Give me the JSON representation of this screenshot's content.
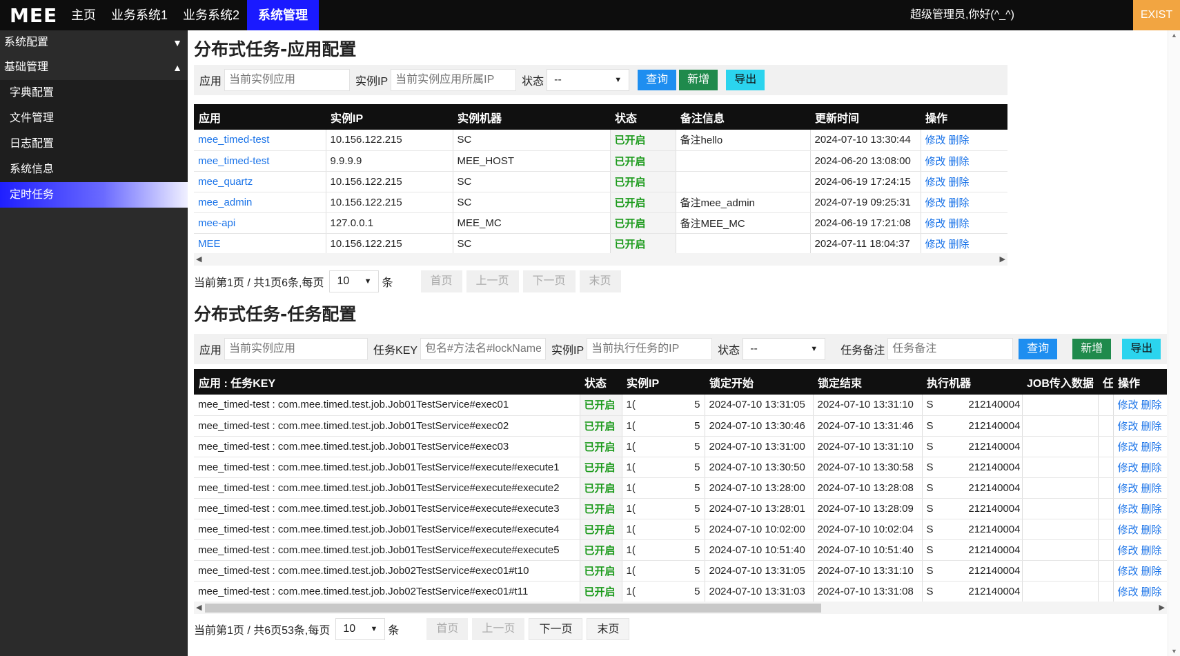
{
  "header": {
    "logo": "MEE",
    "nav": [
      "主页",
      "业务系统1",
      "业务系统2",
      "系统管理"
    ],
    "active_nav": "系统管理",
    "greeting": "超级管理员,你好(^_^)",
    "exit_label": "EXIST"
  },
  "sidebar": {
    "groups": [
      {
        "label": "系统配置",
        "caret": "▼"
      },
      {
        "label": "基础管理",
        "caret": "▲"
      }
    ],
    "items": [
      "字典配置",
      "文件管理",
      "日志配置",
      "系统信息",
      "定时任务"
    ],
    "active_item": "定时任务"
  },
  "app_section": {
    "title": "分布式任务-应用配置",
    "filter": {
      "app_label": "应用",
      "app_placeholder": "当前实例应用",
      "ip_label": "实例IP",
      "ip_placeholder": "当前实例应用所属IP",
      "status_label": "状态",
      "status_value": "--",
      "query": "查询",
      "add": "新增",
      "export": "导出"
    },
    "columns": [
      "应用",
      "实例IP",
      "实例机器",
      "状态",
      "备注信息",
      "更新时间",
      "操作"
    ],
    "rows": [
      {
        "app": "mee_timed-test",
        "ip": "10.156.122.215",
        "machine": "SC",
        "status": "已开启",
        "remark": "备注hello",
        "updated": "2024-07-10 13:30:44"
      },
      {
        "app": "mee_timed-test",
        "ip": "9.9.9.9",
        "machine": "MEE_HOST",
        "status": "已开启",
        "remark": "",
        "updated": "2024-06-20 13:08:00"
      },
      {
        "app": "mee_quartz",
        "ip": "10.156.122.215",
        "machine": "SC",
        "status": "已开启",
        "remark": "",
        "updated": "2024-06-19 17:24:15"
      },
      {
        "app": "mee_admin",
        "ip": "10.156.122.215",
        "machine": "SC",
        "status": "已开启",
        "remark": "备注mee_admin",
        "updated": "2024-07-19 09:25:31"
      },
      {
        "app": "mee-api",
        "ip": "127.0.0.1",
        "machine": "MEE_MC",
        "status": "已开启",
        "remark": "备注MEE_MC",
        "updated": "2024-06-19 17:21:08"
      },
      {
        "app": "MEE",
        "ip": "10.156.122.215",
        "machine": "SC",
        "status": "已开启",
        "remark": "",
        "updated": "2024-07-11 18:04:37"
      }
    ],
    "op_edit": "修改",
    "op_delete": "删除",
    "pager": {
      "summary": "当前第1页 / 共1页6条,每页",
      "page_size": "10",
      "unit": "条",
      "first": "首页",
      "prev": "上一页",
      "next": "下一页",
      "last": "末页"
    }
  },
  "task_section": {
    "title": "分布式任务-任务配置",
    "filter": {
      "app_label": "应用",
      "app_placeholder": "当前实例应用",
      "key_label": "任务KEY",
      "key_placeholder": "包名#方法名#lockName",
      "ip_label": "实例IP",
      "ip_placeholder": "当前执行任务的IP",
      "status_label": "状态",
      "status_value": "--",
      "remark_label": "任务备注",
      "remark_placeholder": "任务备注",
      "query": "查询",
      "add": "新增",
      "export": "导出"
    },
    "columns": [
      "应用 : 任务KEY",
      "状态",
      "实例IP",
      "锁定开始",
      "锁定结束",
      "执行机器",
      "JOB传入数据",
      "任",
      "操作"
    ],
    "rows": [
      {
        "key": "mee_timed-test : com.mee.timed.test.job.Job01TestService#exec01",
        "status": "已开启",
        "ip": "1(",
        "ip_tail": "5",
        "lock_start": "2024-07-10 13:31:05",
        "lock_end": "2024-07-10 13:31:10",
        "machine": "S",
        "machine_tail": "212140004"
      },
      {
        "key": "mee_timed-test : com.mee.timed.test.job.Job01TestService#exec02",
        "status": "已开启",
        "ip": "1(",
        "ip_tail": "5",
        "lock_start": "2024-07-10 13:30:46",
        "lock_end": "2024-07-10 13:31:46",
        "machine": "S",
        "machine_tail": "212140004"
      },
      {
        "key": "mee_timed-test : com.mee.timed.test.job.Job01TestService#exec03",
        "status": "已开启",
        "ip": "1(",
        "ip_tail": "5",
        "lock_start": "2024-07-10 13:31:00",
        "lock_end": "2024-07-10 13:31:10",
        "machine": "S",
        "machine_tail": "212140004"
      },
      {
        "key": "mee_timed-test : com.mee.timed.test.job.Job01TestService#execute#execute1",
        "status": "已开启",
        "ip": "1(",
        "ip_tail": "5",
        "lock_start": "2024-07-10 13:30:50",
        "lock_end": "2024-07-10 13:30:58",
        "machine": "S",
        "machine_tail": "212140004"
      },
      {
        "key": "mee_timed-test : com.mee.timed.test.job.Job01TestService#execute#execute2",
        "status": "已开启",
        "ip": "1(",
        "ip_tail": "5",
        "lock_start": "2024-07-10 13:28:00",
        "lock_end": "2024-07-10 13:28:08",
        "machine": "S",
        "machine_tail": "212140004"
      },
      {
        "key": "mee_timed-test : com.mee.timed.test.job.Job01TestService#execute#execute3",
        "status": "已开启",
        "ip": "1(",
        "ip_tail": "5",
        "lock_start": "2024-07-10 13:28:01",
        "lock_end": "2024-07-10 13:28:09",
        "machine": "S",
        "machine_tail": "212140004"
      },
      {
        "key": "mee_timed-test : com.mee.timed.test.job.Job01TestService#execute#execute4",
        "status": "已开启",
        "ip": "1(",
        "ip_tail": "5",
        "lock_start": "2024-07-10 10:02:00",
        "lock_end": "2024-07-10 10:02:04",
        "machine": "S",
        "machine_tail": "212140004"
      },
      {
        "key": "mee_timed-test : com.mee.timed.test.job.Job01TestService#execute#execute5",
        "status": "已开启",
        "ip": "1(",
        "ip_tail": "5",
        "lock_start": "2024-07-10 10:51:40",
        "lock_end": "2024-07-10 10:51:40",
        "machine": "S",
        "machine_tail": "212140004"
      },
      {
        "key": "mee_timed-test : com.mee.timed.test.job.Job02TestService#exec01#t10",
        "status": "已开启",
        "ip": "1(",
        "ip_tail": "5",
        "lock_start": "2024-07-10 13:31:05",
        "lock_end": "2024-07-10 13:31:10",
        "machine": "S",
        "machine_tail": "212140004"
      },
      {
        "key": "mee_timed-test : com.mee.timed.test.job.Job02TestService#exec01#t11",
        "status": "已开启",
        "ip": "1(",
        "ip_tail": "5",
        "lock_start": "2024-07-10 13:31:03",
        "lock_end": "2024-07-10 13:31:08",
        "machine": "S",
        "machine_tail": "212140004"
      }
    ],
    "op_edit": "修改",
    "op_delete": "删除",
    "pager": {
      "summary": "当前第1页 / 共6页53条,每页",
      "page_size": "10",
      "unit": "条",
      "first": "首页",
      "prev": "上一页",
      "next": "下一页",
      "last": "末页"
    }
  },
  "colors": {
    "topbar": "#0d0d0d",
    "nav_active": "#1a1aff",
    "exit": "#f2a541",
    "sidebar": "#2b2b2b",
    "status_on": "#1b9a1b",
    "link": "#1a73e8"
  }
}
